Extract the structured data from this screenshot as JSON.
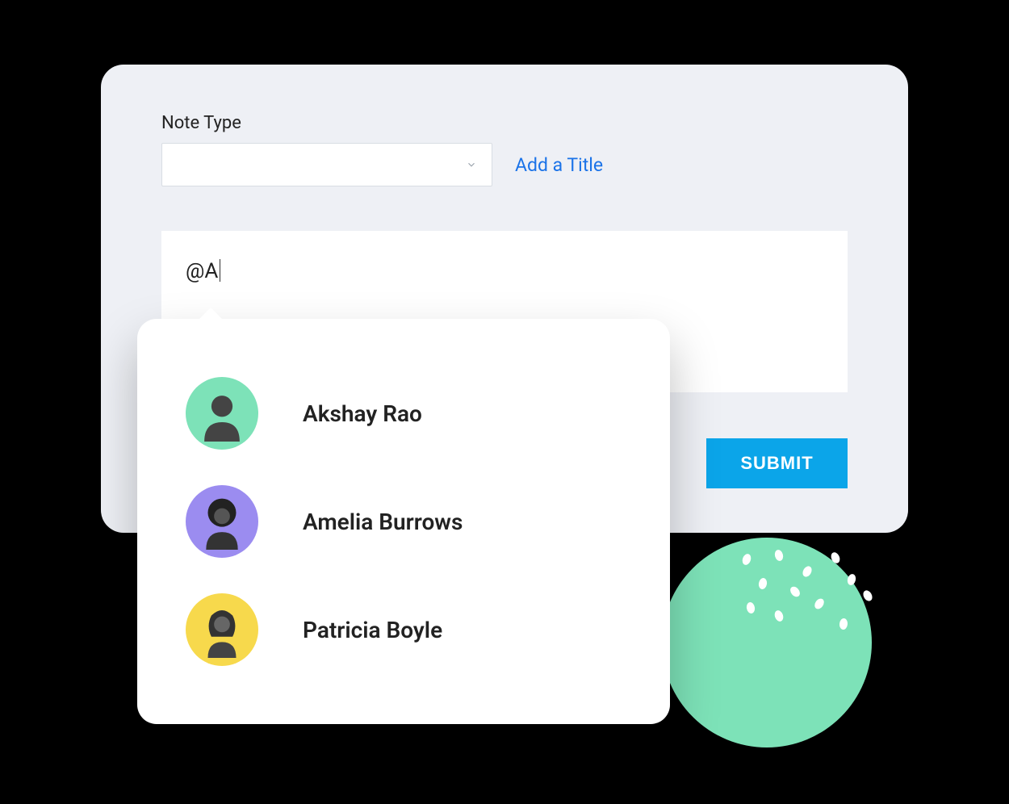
{
  "form": {
    "note_type_label": "Note Type",
    "add_title_link": "Add a Title",
    "mention_text": "@A",
    "submit_label": "SUBMIT"
  },
  "mentions": [
    {
      "name": "Akshay Rao",
      "avatar_bg": "#7de2b8"
    },
    {
      "name": "Amelia Burrows",
      "avatar_bg": "#9b8cf0"
    },
    {
      "name": "Patricia Boyle",
      "avatar_bg": "#f7d94c"
    }
  ]
}
